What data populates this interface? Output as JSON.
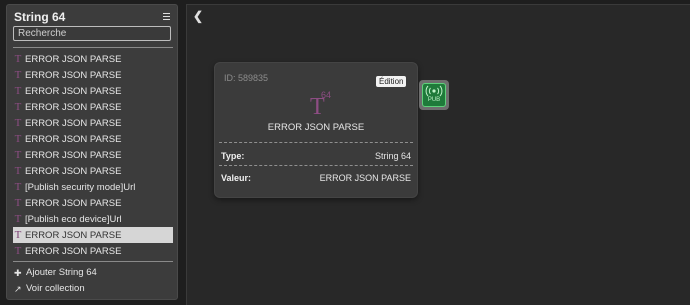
{
  "sidebar": {
    "title": "String 64",
    "search_placeholder": "Recherche",
    "items": [
      {
        "label": "ERROR JSON PARSE"
      },
      {
        "label": "ERROR JSON PARSE"
      },
      {
        "label": "ERROR JSON PARSE"
      },
      {
        "label": "ERROR JSON PARSE"
      },
      {
        "label": "ERROR JSON PARSE"
      },
      {
        "label": "ERROR JSON PARSE"
      },
      {
        "label": "ERROR JSON PARSE"
      },
      {
        "label": "ERROR JSON PARSE"
      },
      {
        "label": "[Publish security mode]Url"
      },
      {
        "label": "ERROR JSON PARSE"
      },
      {
        "label": "[Publish eco device]Url"
      },
      {
        "label": "ERROR JSON PARSE",
        "selected": true
      },
      {
        "label": "ERROR JSON PARSE"
      }
    ],
    "add_label": "Ajouter String 64",
    "view_collection_label": "Voir collection"
  },
  "card": {
    "id_text": "ID:  589835",
    "edit_label": "Édition",
    "logo_sup": "64",
    "logo_letter": "T",
    "name": "ERROR JSON PARSE",
    "type_key": "Type:",
    "type_value": "String 64",
    "value_key": "Valeur:",
    "value_value": "ERROR JSON PARSE"
  },
  "pub_widget": {
    "label": "PUB",
    "icon": "broadcast-icon"
  },
  "colors": {
    "accent_purple": "#8e4d84",
    "pub_green": "#1f7a3a"
  }
}
